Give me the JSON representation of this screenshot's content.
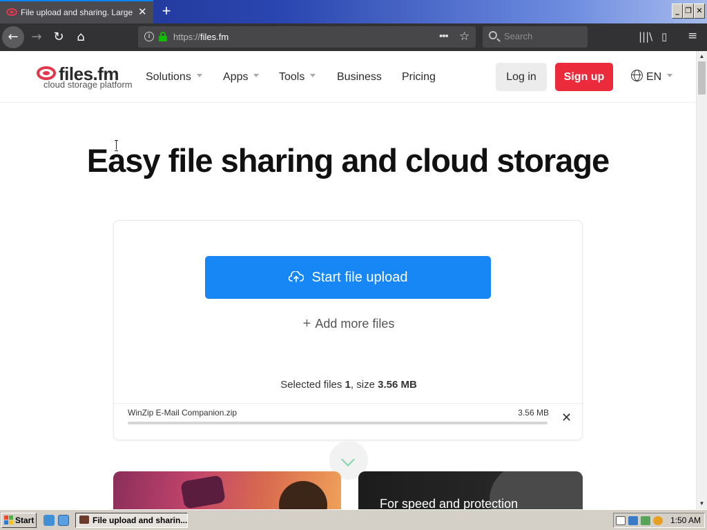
{
  "browser": {
    "tab_title": "File upload and sharing. Large file",
    "tab_close": "✕",
    "new_tab": "+",
    "window_buttons": {
      "minimize": "_",
      "restore": "❐",
      "close": "✕"
    },
    "url_prefix": "https://",
    "url_host": "files.fm",
    "page_actions": "•••",
    "bookmark_star": "☆",
    "search_placeholder": "Search",
    "toolbar_icons": {
      "library": "|||\\",
      "sidebar": "▯",
      "menu": "≡"
    },
    "nav_icons": {
      "back": "←",
      "forward": "→",
      "reload": "↻",
      "home": "⌂"
    }
  },
  "site": {
    "logo_name": "files.fm",
    "logo_tagline": "cloud storage platform",
    "nav": [
      {
        "label": "Solutions",
        "dropdown": true
      },
      {
        "label": "Apps",
        "dropdown": true
      },
      {
        "label": "Tools",
        "dropdown": true
      },
      {
        "label": "Business",
        "dropdown": false
      },
      {
        "label": "Pricing",
        "dropdown": false
      }
    ],
    "login_label": "Log in",
    "signup_label": "Sign up",
    "language": "EN"
  },
  "hero": {
    "title": "Easy file sharing and cloud storage"
  },
  "upload": {
    "start_label": "Start file upload",
    "add_more_label": "Add more files",
    "selected_prefix": "Selected files ",
    "selected_count": "1",
    "size_prefix": ", size ",
    "total_size": "3.56 MB",
    "file": {
      "name": "WinZip E-Mail Companion.zip",
      "size": "3.56 MB",
      "remove": "✕",
      "progress": 1.0
    }
  },
  "promos": {
    "right_text": "For speed and protection"
  },
  "taskbar": {
    "start_label": "Start",
    "task_label": "File upload and sharin...",
    "clock": "1:50 AM"
  },
  "colors": {
    "upload_button": "#1787f5",
    "signup_button": "#eb2a3c",
    "browser_toolbar": "#323234",
    "lock_green": "#12bc00"
  }
}
